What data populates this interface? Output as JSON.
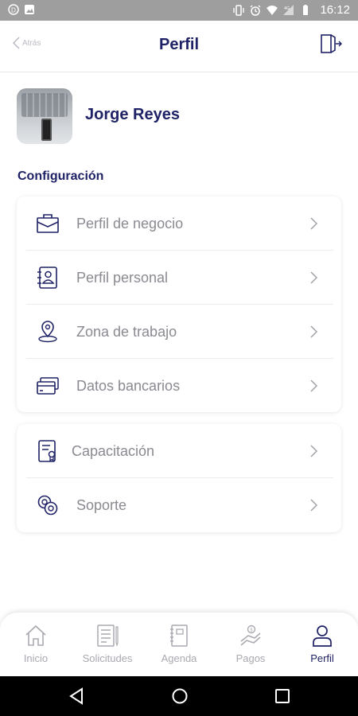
{
  "statusbar": {
    "time": "16:12"
  },
  "header": {
    "back_label": "Atrás",
    "title": "Perfil"
  },
  "profile": {
    "name": "Jorge Reyes"
  },
  "section": {
    "title": "Configuración"
  },
  "menu1": [
    {
      "label": "Perfil de negocio",
      "icon": "briefcase-icon"
    },
    {
      "label": "Perfil personal",
      "icon": "contact-book-icon"
    },
    {
      "label": "Zona de trabajo",
      "icon": "location-pin-icon"
    },
    {
      "label": "Datos bancarios",
      "icon": "credit-card-icon"
    }
  ],
  "menu2": [
    {
      "label": "Capacitación",
      "icon": "certificate-icon"
    },
    {
      "label": "Soporte",
      "icon": "support-icon"
    }
  ],
  "bottomnav": [
    {
      "label": "Inicio",
      "icon": "home-icon"
    },
    {
      "label": "Solicitudes",
      "icon": "requests-icon"
    },
    {
      "label": "Agenda",
      "icon": "agenda-icon"
    },
    {
      "label": "Pagos",
      "icon": "payments-icon"
    },
    {
      "label": "Perfil",
      "icon": "user-icon",
      "active": true
    }
  ],
  "colors": {
    "primary": "#1f2266",
    "muted": "#8a8a92",
    "inactive": "#a9a9b2"
  }
}
